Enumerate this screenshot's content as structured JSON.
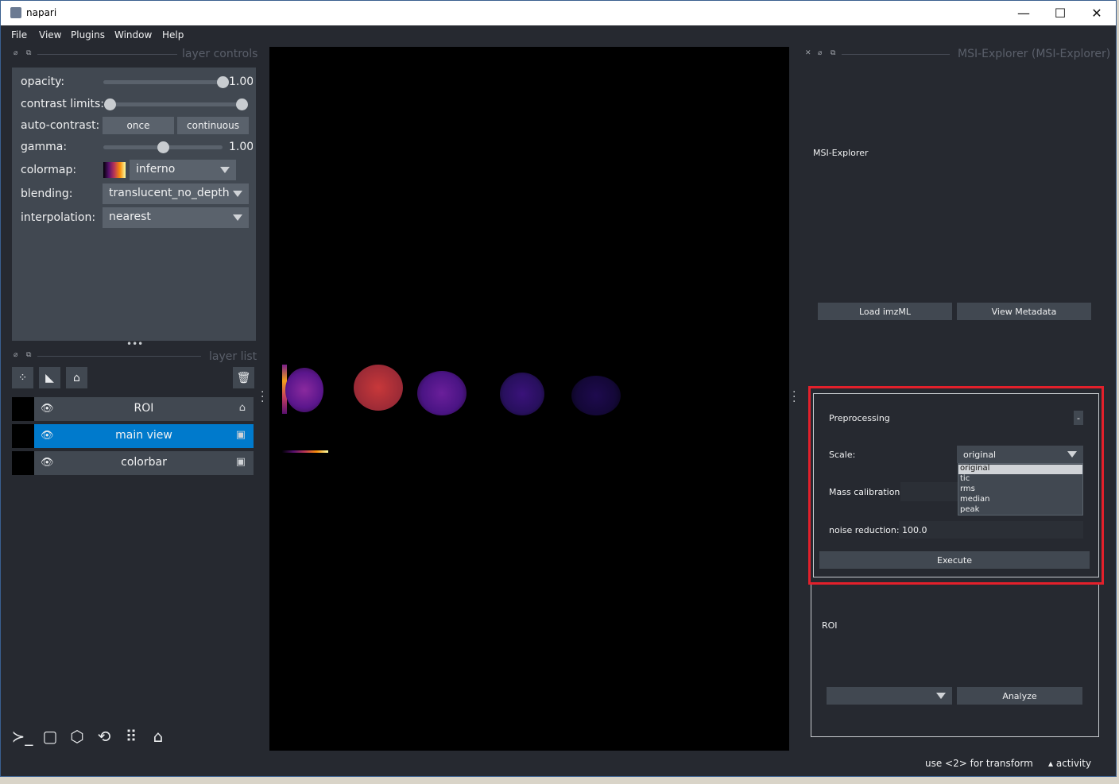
{
  "window": {
    "title": "napari",
    "minimize": "—",
    "maximize": "☐",
    "close": "✕"
  },
  "menu": [
    "File",
    "View",
    "Plugins",
    "Window",
    "Help"
  ],
  "layer_controls": {
    "header": "layer controls",
    "opacity_label": "opacity:",
    "opacity_value": "1.00",
    "contrast_label": "contrast limits:",
    "autocontrast_label": "auto-contrast:",
    "once": "once",
    "continuous": "continuous",
    "gamma_label": "gamma:",
    "gamma_value": "1.00",
    "colormap_label": "colormap:",
    "colormap_value": "inferno",
    "blending_label": "blending:",
    "blending_value": "translucent_no_depth",
    "interpolation_label": "interpolation:",
    "interpolation_value": "nearest",
    "opacity_fraction": 1.0,
    "gamma_fraction": 0.5
  },
  "layer_list": {
    "header": "layer list",
    "layers": [
      {
        "name": "ROI",
        "type": "labels",
        "selected": false
      },
      {
        "name": "main view",
        "type": "image",
        "selected": true
      },
      {
        "name": "colorbar",
        "type": "image",
        "selected": false
      }
    ]
  },
  "icons": {
    "points": "points-icon",
    "shapes": "shapes-icon",
    "labels": "labels-icon",
    "delete": "trash-icon",
    "console": "console-icon",
    "square": "square-icon",
    "ndisplay": "cube-icon",
    "roll": "rotate-icon",
    "grid": "grid-icon",
    "home": "home-icon",
    "eye": "eye-icon"
  },
  "plugin": {
    "header": "MSI-Explorer (MSI-Explorer)",
    "title": "MSI-Explorer",
    "load_btn": "Load imzML",
    "meta_btn": "View Metadata",
    "preprocessing": {
      "title": "Preprocessing",
      "collapse": "-",
      "scale_label": "Scale:",
      "scale_value": "original",
      "scale_options": [
        "original",
        "tic",
        "rms",
        "median",
        "peak"
      ],
      "mass_label": "Mass calibration:",
      "noise_label": "noise reduction:",
      "noise_value": "100.0",
      "execute": "Execute"
    },
    "roi": {
      "title": "ROI",
      "analyze": "Analyze"
    }
  },
  "status": {
    "hint": "use <2> for transform",
    "activity": "activity"
  },
  "colors": {
    "bg": "#262930",
    "panel": "#414851",
    "selected": "#007acc",
    "highlight": "#e3202b"
  }
}
